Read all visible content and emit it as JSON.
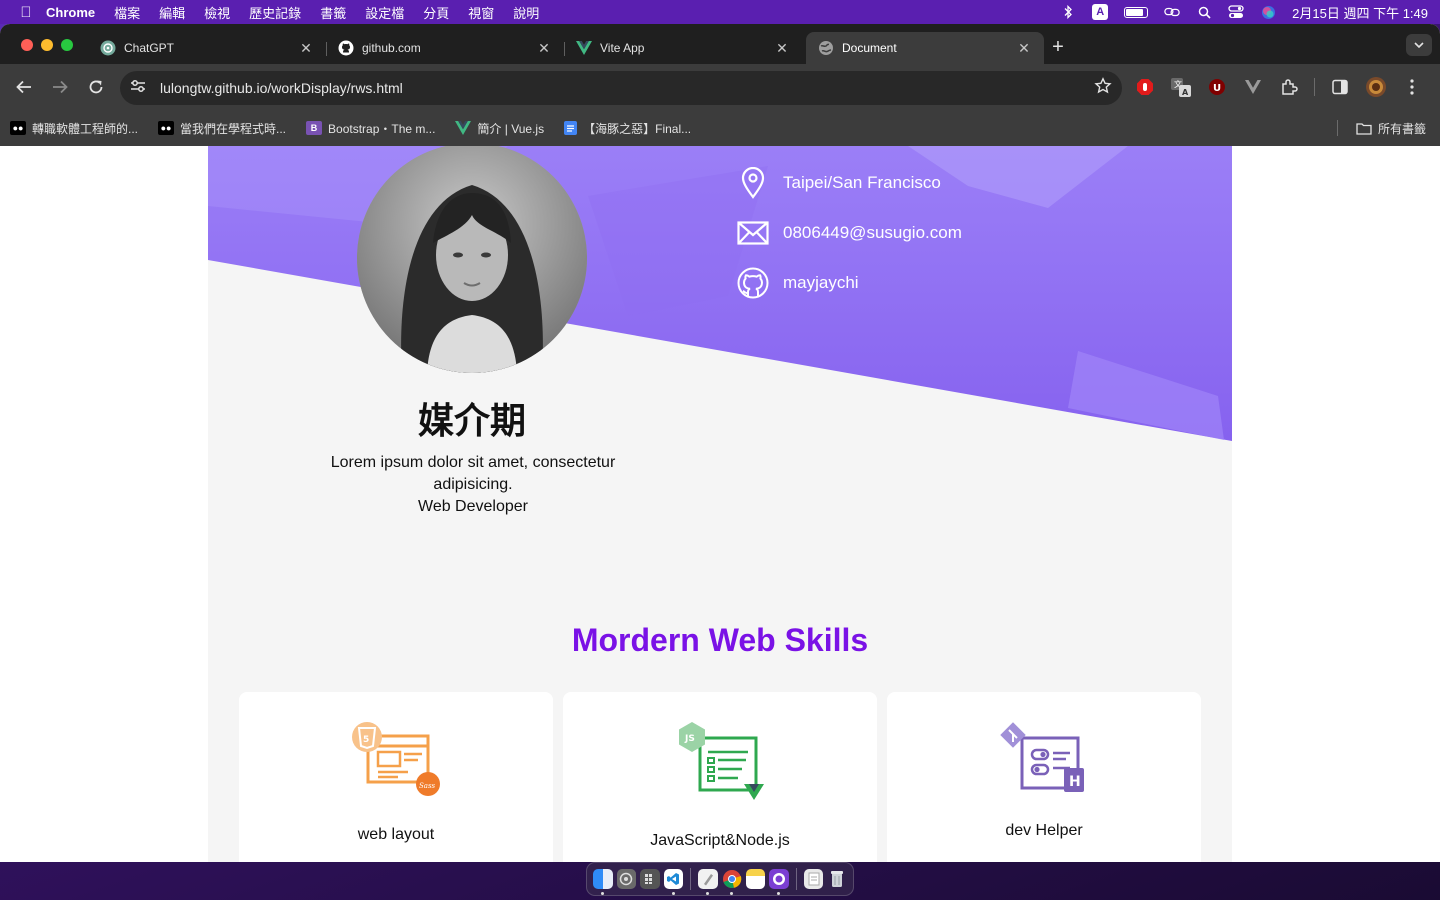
{
  "menubar": {
    "app_name": "Chrome",
    "items": [
      "檔案",
      "編輯",
      "檢視",
      "歷史記錄",
      "書籤",
      "設定檔",
      "分頁",
      "視窗",
      "說明"
    ],
    "input_badge": "A",
    "datetime": "2月15日 週四 下午 1:49"
  },
  "tabs": [
    {
      "title": "ChatGPT",
      "icon": "chatgpt-icon"
    },
    {
      "title": "github.com",
      "icon": "github-icon"
    },
    {
      "title": "Vite App",
      "icon": "vue-icon"
    },
    {
      "title": "Document",
      "icon": "globe-icon",
      "active": true
    }
  ],
  "toolbar": {
    "url": "lulongtw.github.io/workDisplay/rws.html"
  },
  "bookmarks": {
    "items": [
      {
        "label": "轉職軟體工程師的...",
        "icon": "medium-icon"
      },
      {
        "label": "當我們在學程式時...",
        "icon": "medium-icon"
      },
      {
        "label": "Bootstrap・The m...",
        "icon": "bootstrap-icon"
      },
      {
        "label": "簡介 | Vue.js",
        "icon": "vue-icon"
      },
      {
        "label": "【海豚之惡】Final...",
        "icon": "docs-icon"
      }
    ],
    "all_label": "所有書籤"
  },
  "profile": {
    "name": "媒介期",
    "bio": "Lorem ipsum dolor sit amet, consectetur adipisicing.",
    "role": "Web Developer",
    "contacts": [
      {
        "icon": "location-pin-icon",
        "text": "Taipei/San Francisco"
      },
      {
        "icon": "mail-icon",
        "text": "0806449@susugio.com"
      },
      {
        "icon": "github-icon",
        "text": "mayjaychi"
      }
    ]
  },
  "skills": {
    "title": "Mordern Web Skills",
    "cards": [
      {
        "label": "web layout",
        "icon": "html5-sass-icon"
      },
      {
        "label": "JavaScript&Node.js",
        "icon": "nodejs-vue-icon"
      },
      {
        "label": "dev Helper",
        "icon": "git-heroku-icon"
      }
    ]
  },
  "colors": {
    "accent": "#7a12e6",
    "hero": "#8b6cf0",
    "menubar": "#5a1fb0"
  }
}
